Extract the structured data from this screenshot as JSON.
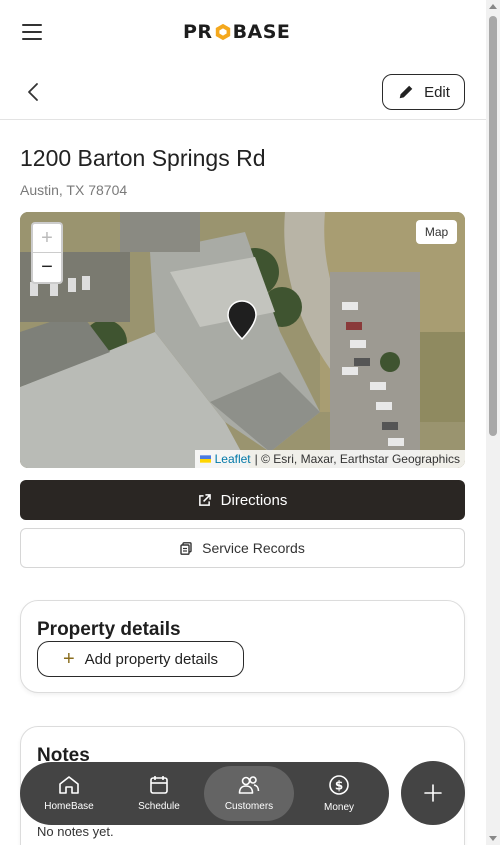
{
  "header": {
    "logo_text_left": "PR",
    "logo_text_right": "BASE",
    "brand_accent": "#f4a81d"
  },
  "subbar": {
    "edit_label": "Edit"
  },
  "property": {
    "street": "1200 Barton Springs Rd",
    "city_state_zip": "Austin, TX 78704"
  },
  "map": {
    "zoom_in": "+",
    "zoom_out": "−",
    "layer_button": "Map",
    "attribution_link": "Leaflet",
    "attribution_text": "| © Esri, Maxar, Earthstar Geographics"
  },
  "actions": {
    "directions_label": "Directions",
    "service_records_label": "Service Records"
  },
  "property_details": {
    "heading": "Property details",
    "add_label": "Add property details"
  },
  "notes": {
    "heading": "Notes",
    "empty_text": "No notes yet."
  },
  "bottom_nav": {
    "items": [
      {
        "label": "HomeBase",
        "icon": "home-icon",
        "active": false
      },
      {
        "label": "Schedule",
        "icon": "calendar-icon",
        "active": false
      },
      {
        "label": "Customers",
        "icon": "users-icon",
        "active": true
      },
      {
        "label": "Money",
        "icon": "dollar-icon",
        "active": false
      }
    ]
  },
  "colors": {
    "dark_button": "#2a2623",
    "nav_bg": "#444444",
    "nav_active": "#646464"
  }
}
